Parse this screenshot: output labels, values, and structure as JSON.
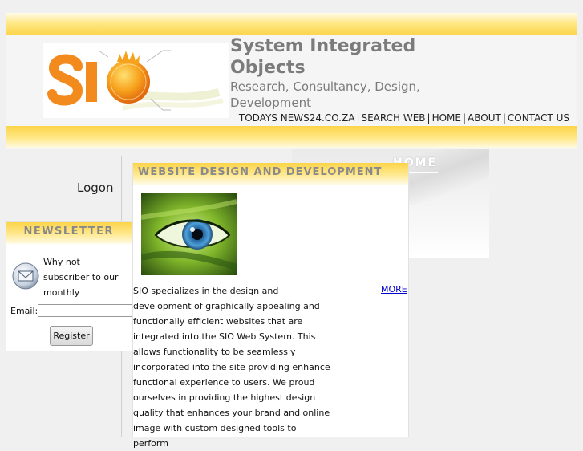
{
  "header": {
    "logo_text": "SIO",
    "title": "System Integrated Objects",
    "tagline": "Research, Consultancy, Design, Development",
    "nav": [
      {
        "label": "TODAYS NEWS24.CO.ZA"
      },
      {
        "label": "SEARCH WEB"
      },
      {
        "label": "HOME"
      },
      {
        "label": "ABOUT"
      },
      {
        "label": "CONTACT US"
      }
    ],
    "nav_separator": "|"
  },
  "banner": {
    "label": "HOME"
  },
  "sidebar": {
    "logon_label": "Logon",
    "newsletter": {
      "title": "NEWSLETTER",
      "text": "Why not subscriber to our monthly newsletter!",
      "email_label": "Email:",
      "email_value": "",
      "register_label": "Register"
    }
  },
  "main": {
    "section_title": "WEBSITE DESIGN AND DEVELOPMENT",
    "body": "SIO specializes in the design and development of graphically appealing and functionally efficient websites that are integrated into the SIO Web System. This allows functionality to be seamlessly incorporated into the site providing enhance functional experience to users. We proud ourselves in providing the highest design quality that enhances your brand and online image with custom designed tools to perform",
    "more_label": "MORE"
  },
  "colors": {
    "accent_yellow": "#fcd448",
    "heading_gray": "#7b7b7b",
    "link_blue": "#0000cc",
    "logo_orange": "#f28a1e"
  }
}
